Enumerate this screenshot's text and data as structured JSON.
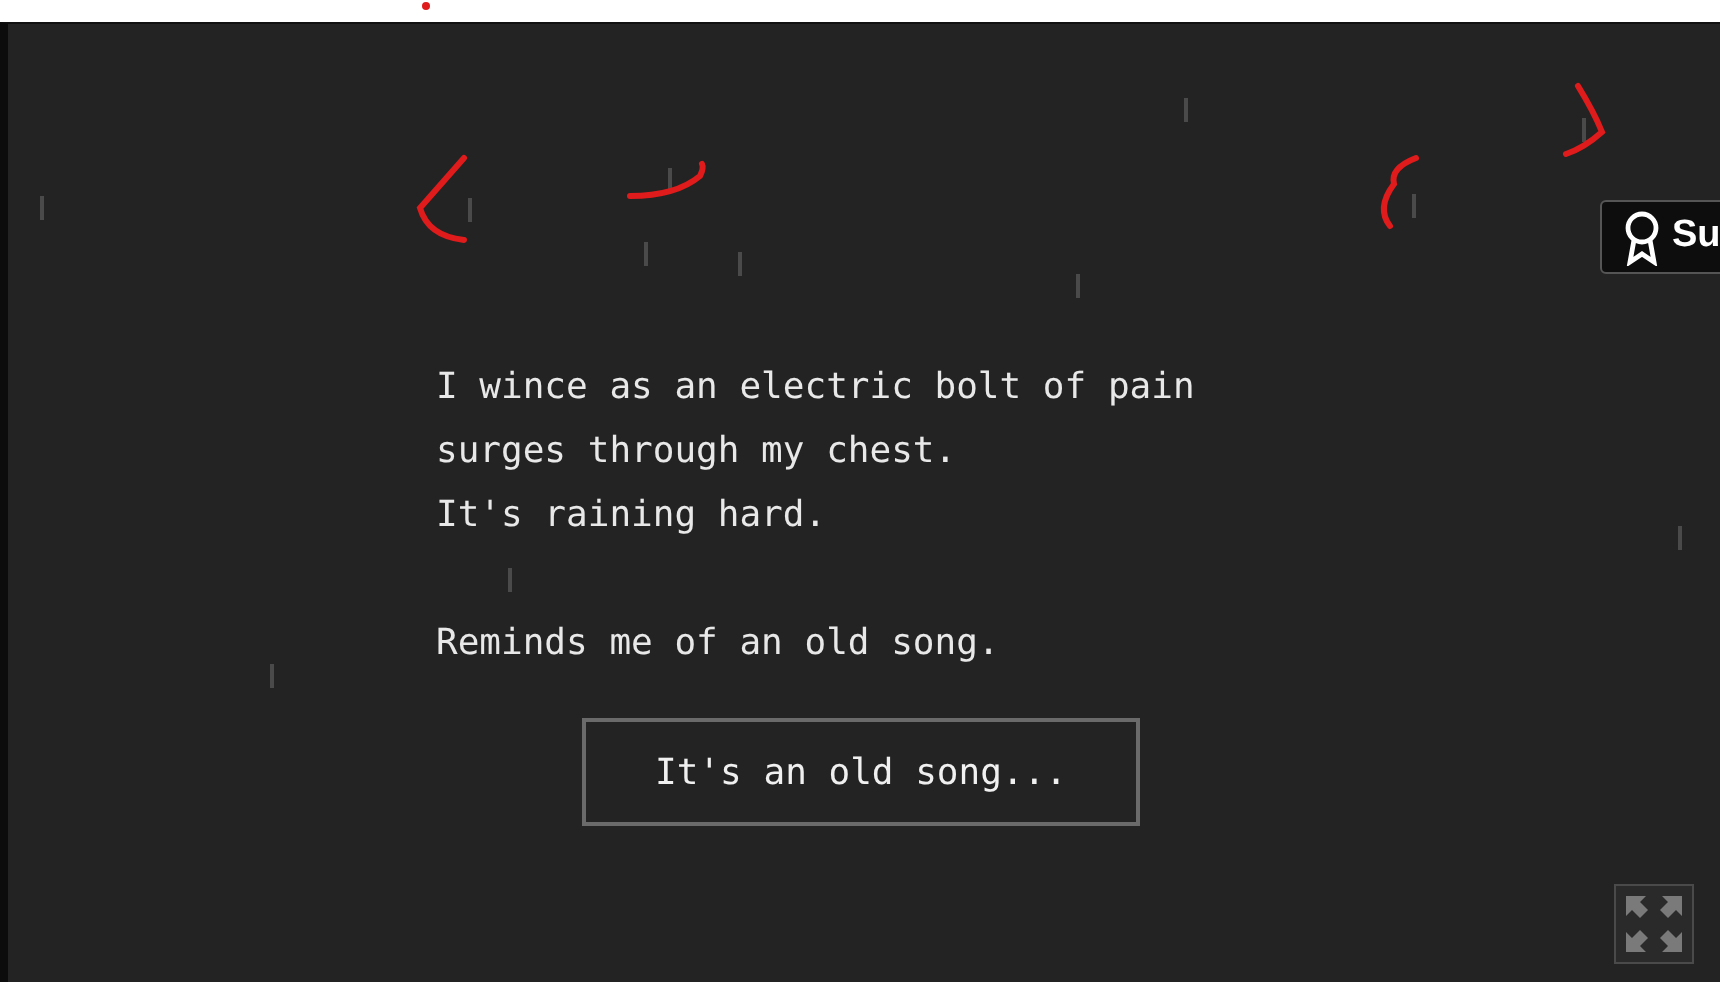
{
  "story": {
    "paragraphs": [
      [
        "I wince as an electric bolt of pain",
        "surges through my chest.",
        "It's raining hard."
      ],
      [
        "Reminds me of an old song."
      ]
    ]
  },
  "choices": [
    "It's an old song..."
  ],
  "badge": {
    "label": "Su"
  }
}
